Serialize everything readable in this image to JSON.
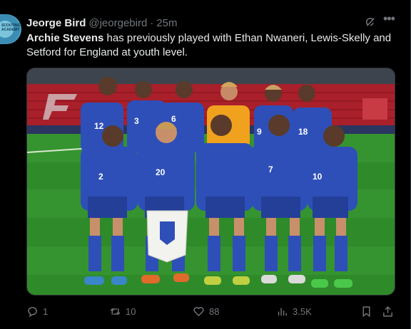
{
  "author": {
    "name": "Jeorge Bird",
    "handle": "@jeorgebird",
    "separator": "·",
    "time": "25m",
    "avatar_text": "SCOUTING ACADEMY"
  },
  "tweet": {
    "bold_name": "Archie Stevens",
    "text_rest": " has previously played with Ethan Nwaneri, Lewis-Skelly and Setford for England at youth level."
  },
  "media": {
    "alt": "England youth team photo",
    "jersey_color": "#2e4fb8",
    "pitch_color": "#2f8a2a",
    "stand_color": "#b2202a"
  },
  "actions": {
    "replies": "1",
    "reposts": "10",
    "likes": "88",
    "views": "3.5K"
  },
  "icons": [
    "grok-icon",
    "more-icon",
    "reply-icon",
    "repost-icon",
    "like-icon",
    "views-icon",
    "bookmark-icon",
    "share-icon"
  ]
}
